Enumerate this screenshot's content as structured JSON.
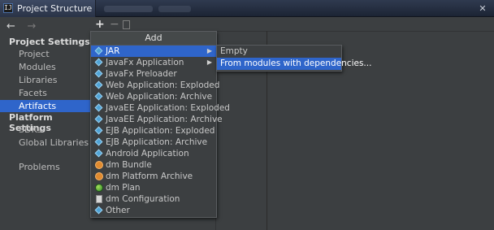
{
  "window": {
    "title": "Project Structure",
    "app_icon_label": "IJ",
    "close_glyph": "✕"
  },
  "nav": {
    "back_glyph": "←",
    "forward_glyph": "→"
  },
  "left_panel": {
    "project_settings_heading": "Project Settings",
    "project_items": [
      {
        "label": "Project"
      },
      {
        "label": "Modules"
      },
      {
        "label": "Libraries"
      },
      {
        "label": "Facets"
      },
      {
        "label": "Artifacts",
        "selected": true
      }
    ],
    "platform_settings_heading": "Platform Settings",
    "platform_items": [
      {
        "label": "SDKs"
      },
      {
        "label": "Global Libraries"
      }
    ],
    "problems_label": "Problems"
  },
  "toolbar": {
    "add_glyph": "+",
    "remove_glyph": "−"
  },
  "add_popup": {
    "title": "Add",
    "items": [
      {
        "label": "JAR",
        "icon": "jar-icon",
        "highlight": true,
        "submenu": true
      },
      {
        "label": "JavaFx Application",
        "icon": "javafx-icon",
        "submenu": true
      },
      {
        "label": "JavaFx Preloader",
        "icon": "javafx-icon"
      },
      {
        "label": "Web Application: Exploded",
        "icon": "web-icon"
      },
      {
        "label": "Web Application: Archive",
        "icon": "web-icon"
      },
      {
        "label": "JavaEE Application: Exploded",
        "icon": "javaee-icon"
      },
      {
        "label": "JavaEE Application: Archive",
        "icon": "javaee-icon"
      },
      {
        "label": "EJB Application: Exploded",
        "icon": "ejb-icon"
      },
      {
        "label": "EJB Application: Archive",
        "icon": "ejb-icon"
      },
      {
        "label": "Android Application",
        "icon": "android-icon"
      },
      {
        "label": "dm Bundle",
        "icon": "bundle-icon"
      },
      {
        "label": "dm Platform Archive",
        "icon": "platform-archive-icon"
      },
      {
        "label": "dm Plan",
        "icon": "plan-icon"
      },
      {
        "label": "dm Configuration",
        "icon": "config-icon"
      },
      {
        "label": "Other",
        "icon": "other-icon"
      }
    ],
    "submenu_arrow_glyph": "▶"
  },
  "jar_submenu": {
    "items": [
      {
        "label": "Empty"
      },
      {
        "label": "From modules with dependencies...",
        "highlight": true
      }
    ]
  },
  "colors": {
    "selection": "#2f65ca",
    "background": "#3c3f41",
    "titlebar": "#2f3a4f"
  }
}
